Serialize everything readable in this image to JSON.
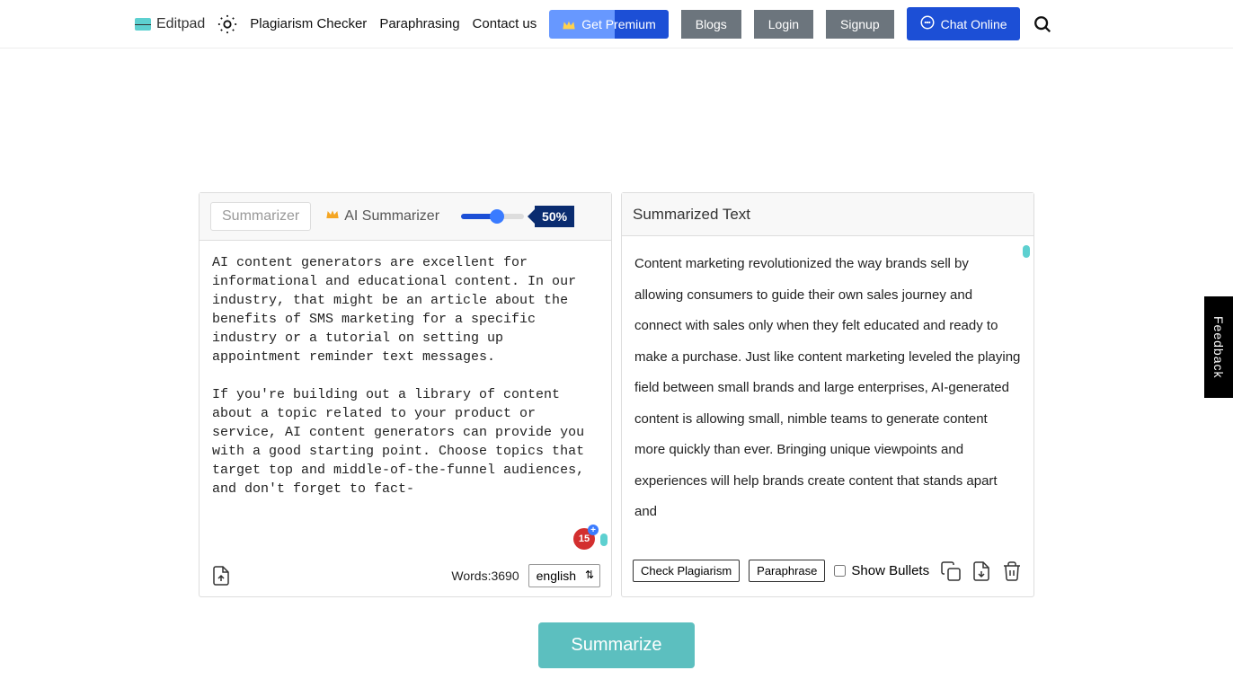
{
  "header": {
    "logo_text": "Editpad",
    "nav": {
      "plagiarism": "Plagiarism Checker",
      "paraphrasing": "Paraphrasing",
      "contact": "Contact us"
    },
    "premium": "Get Premium",
    "blogs": "Blogs",
    "login": "Login",
    "signup": "Signup",
    "chat": "Chat Online"
  },
  "left_panel": {
    "tab_summarizer": "Summarizer",
    "tab_ai_summarizer": "AI Summarizer",
    "slider_value": "50%",
    "input_text": "AI content generators are excellent for informational and educational content. In our industry, that might be an article about the benefits of SMS marketing for a specific industry or a tutorial on setting up appointment reminder text messages.\n\nIf you're building out a library of content about a topic related to your product or service, AI content generators can provide you with a good starting point. Choose topics that target top and middle-of-the-funnel audiences, and don't forget to fact-",
    "badge_count": "15",
    "word_label": "Words:",
    "word_count": "3690",
    "language": "english"
  },
  "right_panel": {
    "title": "Summarized Text",
    "output_text": "Content marketing revolutionized the way brands sell by allowing consumers to guide their own sales journey and connect with sales only when they felt educated and ready to make a purchase.\nJust like content marketing leveled the playing field between small brands and large enterprises, AI-generated content is allowing small, nimble teams to generate content more quickly than ever.\nBringing unique viewpoints and experiences will help brands create content that stands apart and",
    "check_plagiarism": "Check Plagiarism",
    "paraphrase": "Paraphrase",
    "show_bullets": "Show Bullets"
  },
  "summarize_button": "Summarize",
  "feedback": "Feedback"
}
